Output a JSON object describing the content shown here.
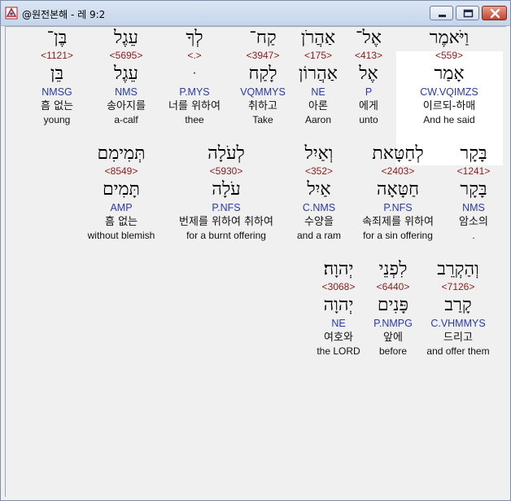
{
  "window": {
    "title": "@원전본해 - 레 9:2"
  },
  "words": [
    {
      "heb": "וַיֹּאמֶר",
      "num": "<559>",
      "lex": "אָמַר",
      "parse": "CW.VQIMZS",
      "kor": "이르되-하매",
      "eng": "And he said"
    },
    {
      "heb": "אֶל־",
      "num": "<413>",
      "lex": "אֶל",
      "parse": "P",
      "kor": "에게",
      "eng": "unto"
    },
    {
      "heb": "אַהֲרֹן",
      "num": "<175>",
      "lex": "אַהֲרוֹן",
      "parse": "NE",
      "kor": "아론",
      "eng": "Aaron"
    },
    {
      "heb": "קַח־",
      "num": "<3947>",
      "lex": "לָקַח",
      "parse": "VQMMYS",
      "kor": "취하고",
      "eng": "Take"
    },
    {
      "heb": "לְךָ",
      "num": "<.>",
      "lex": "ּ",
      "parse": "P.MYS",
      "kor": "너를 위하여",
      "eng": "thee"
    },
    {
      "heb": "עֵגֶל",
      "num": "<5695>",
      "lex": "עֵגֶל",
      "parse": "NMS",
      "kor": "송아지를",
      "eng": "a-calf"
    },
    {
      "heb": "בֶּן־",
      "num": "<1121>",
      "lex": "בֵּן",
      "parse": "NMSG",
      "kor": "흠 없는",
      "eng": "young"
    },
    {
      "heb": "בָּקָר",
      "num": "<1241>",
      "lex": "בָּקָר",
      "parse": "NMS",
      "kor": "암소의",
      "eng": "."
    },
    {
      "heb": "לְחַטָּאת",
      "num": "<2403>",
      "lex": "חַטָּאָה",
      "parse": "P.NFS",
      "kor": "속죄제를 위하여",
      "eng": "for a sin offering"
    },
    {
      "heb": "וְאַיִל",
      "num": "<352>",
      "lex": "אַיִל",
      "parse": "C.NMS",
      "kor": "수양을",
      "eng": "and a ram"
    },
    {
      "heb": "לְעֹלָה",
      "num": "<5930>",
      "lex": "עֹלָה",
      "parse": "P.NFS",
      "kor": "번제를 위하여 취하여",
      "eng": "for a burnt offering"
    },
    {
      "heb": "תְּמִימִם",
      "num": "<8549>",
      "lex": "תָּמִים",
      "parse": "AMP",
      "kor": "흠 없는",
      "eng": "without blemish"
    },
    {
      "heb": "וְהַקְרֵב",
      "num": "<7126>",
      "lex": "קָרַב",
      "parse": "C.VHMMYS",
      "kor": "드리고",
      "eng": "and offer them"
    },
    {
      "heb": "לִפְנֵי",
      "num": "<6440>",
      "lex": "פָּנִים",
      "parse": "P.NMPG",
      "kor": "앞에",
      "eng": "before"
    },
    {
      "heb": "יְהוָה׃",
      "num": "<3068>",
      "lex": "יְהוָה",
      "parse": "NE",
      "kor": "여호와",
      "eng": "the LORD"
    }
  ]
}
